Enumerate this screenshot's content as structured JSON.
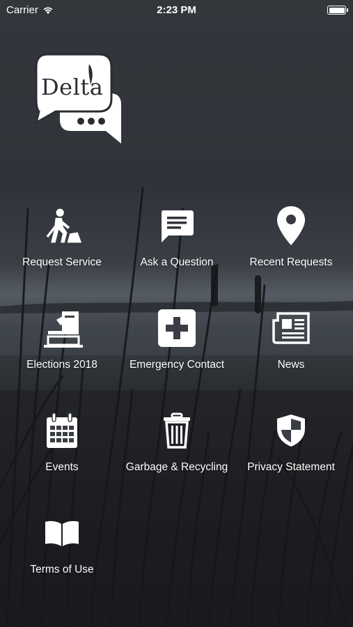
{
  "status_bar": {
    "carrier": "Carrier",
    "time": "2:23 PM"
  },
  "logo": {
    "text": "Delta"
  },
  "menu": [
    {
      "label": "Request Service",
      "icon": "digging-worker-icon"
    },
    {
      "label": "Ask a Question",
      "icon": "chat-bubble-icon"
    },
    {
      "label": "Recent Requests",
      "icon": "map-pin-icon"
    },
    {
      "label": "Elections 2018",
      "icon": "ballot-box-icon"
    },
    {
      "label": "Emergency Contact",
      "icon": "first-aid-icon"
    },
    {
      "label": "News",
      "icon": "newspaper-icon"
    },
    {
      "label": "Events",
      "icon": "calendar-icon"
    },
    {
      "label": "Garbage & Recycling",
      "icon": "trash-can-icon"
    },
    {
      "label": "Privacy Statement",
      "icon": "shield-icon"
    },
    {
      "label": "Terms of Use",
      "icon": "open-book-icon"
    }
  ],
  "colors": {
    "text": "#ffffff",
    "background": "#2a2d31"
  }
}
